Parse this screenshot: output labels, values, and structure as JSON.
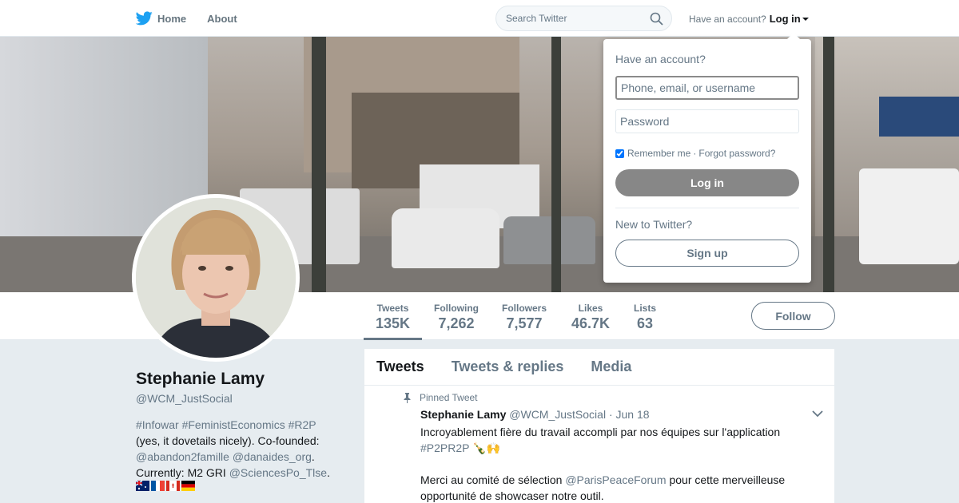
{
  "colors": {
    "brand": "#1da1f2",
    "text_primary": "#14171a",
    "text_secondary": "#657786",
    "page_bg": "#e6ecf0",
    "login_button": "#878787"
  },
  "nav": {
    "home_label": "Home",
    "home_icon": "twitter-bird-icon",
    "about_label": "About",
    "search_placeholder": "Search Twitter",
    "have_account": "Have an account?",
    "login_label": "Log in"
  },
  "login_dropdown": {
    "title": "Have an account?",
    "username_placeholder": "Phone, email, or username",
    "password_placeholder": "Password",
    "remember_label": "Remember me",
    "separator": "·",
    "forgot_label": "Forgot password?",
    "remember_checked": true,
    "login_button": "Log in",
    "new_to_twitter": "New to Twitter?",
    "signup_button": "Sign up"
  },
  "profile": {
    "name": "Stephanie Lamy",
    "handle": "@WCM_JustSocial",
    "bio": {
      "line1": "#Infowar #FeministEconomics #R2P",
      "line2": "(yes, it dovetails nicely). Co-founded:",
      "mention1": "@abandon2famille",
      "mention2": "@danaides_org",
      "period": ".",
      "currently": "Currently: M2 GRI",
      "mention3": "@SciencesPo_Tlse",
      "flags": [
        "australia-flag-icon",
        "france-flag-icon",
        "canada-flag-icon",
        "germany-flag-icon"
      ]
    }
  },
  "stats": [
    {
      "label": "Tweets",
      "value": "135K"
    },
    {
      "label": "Following",
      "value": "7,262"
    },
    {
      "label": "Followers",
      "value": "7,577"
    },
    {
      "label": "Likes",
      "value": "46.7K"
    },
    {
      "label": "Lists",
      "value": "63"
    }
  ],
  "follow_label": "Follow",
  "timeline": {
    "tabs": [
      "Tweets",
      "Tweets & replies",
      "Media"
    ],
    "pinned_label": "Pinned Tweet",
    "tweet": {
      "name": "Stephanie Lamy",
      "handle": "@WCM_JustSocial",
      "date": "· Jun 18",
      "line1": "Incroyablement fière du travail accompli par nos équipes sur l'application",
      "hashtag": "#P2PR2P",
      "emoji": "🍾🙌",
      "line2a": "Merci au comité de sélection",
      "mention": "@ParisPeaceForum",
      "line2b": "pour cette merveilleuse",
      "line3": "opportunité de showcaser notre outil."
    }
  }
}
